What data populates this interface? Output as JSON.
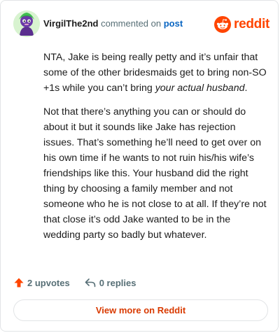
{
  "header": {
    "username": "VirgilThe2nd",
    "action_text": " commented on ",
    "post_link": "post",
    "brand": "reddit"
  },
  "comment": {
    "paragraph1_text": "NTA, Jake is being really petty and it’s unfair that some of the other bridesmaids get to bring non-SO +1s while you can’t bring ",
    "paragraph1_emphasis": "your actual husband",
    "paragraph1_end": ".",
    "paragraph2": "Not that there’s anything you can or should do about it but it sounds like Jake has rejection issues. That’s something he’ll need to get over on his own time if he wants to not ruin his/his wife’s friendships like this. Your husband did the right thing by choosing a family member and not someone who he is not close to at all. If they’re not that close it’s odd Jake wanted to be in the wedding party so badly but whatever."
  },
  "actions": {
    "upvotes_label": "2 upvotes",
    "replies_label": "0 replies"
  },
  "footer": {
    "view_more_label": "View more on Reddit"
  },
  "colors": {
    "brand": "#ff4500",
    "link": "#0a66c2",
    "upvote": "#ff4500",
    "view_more": "#d93a00"
  }
}
